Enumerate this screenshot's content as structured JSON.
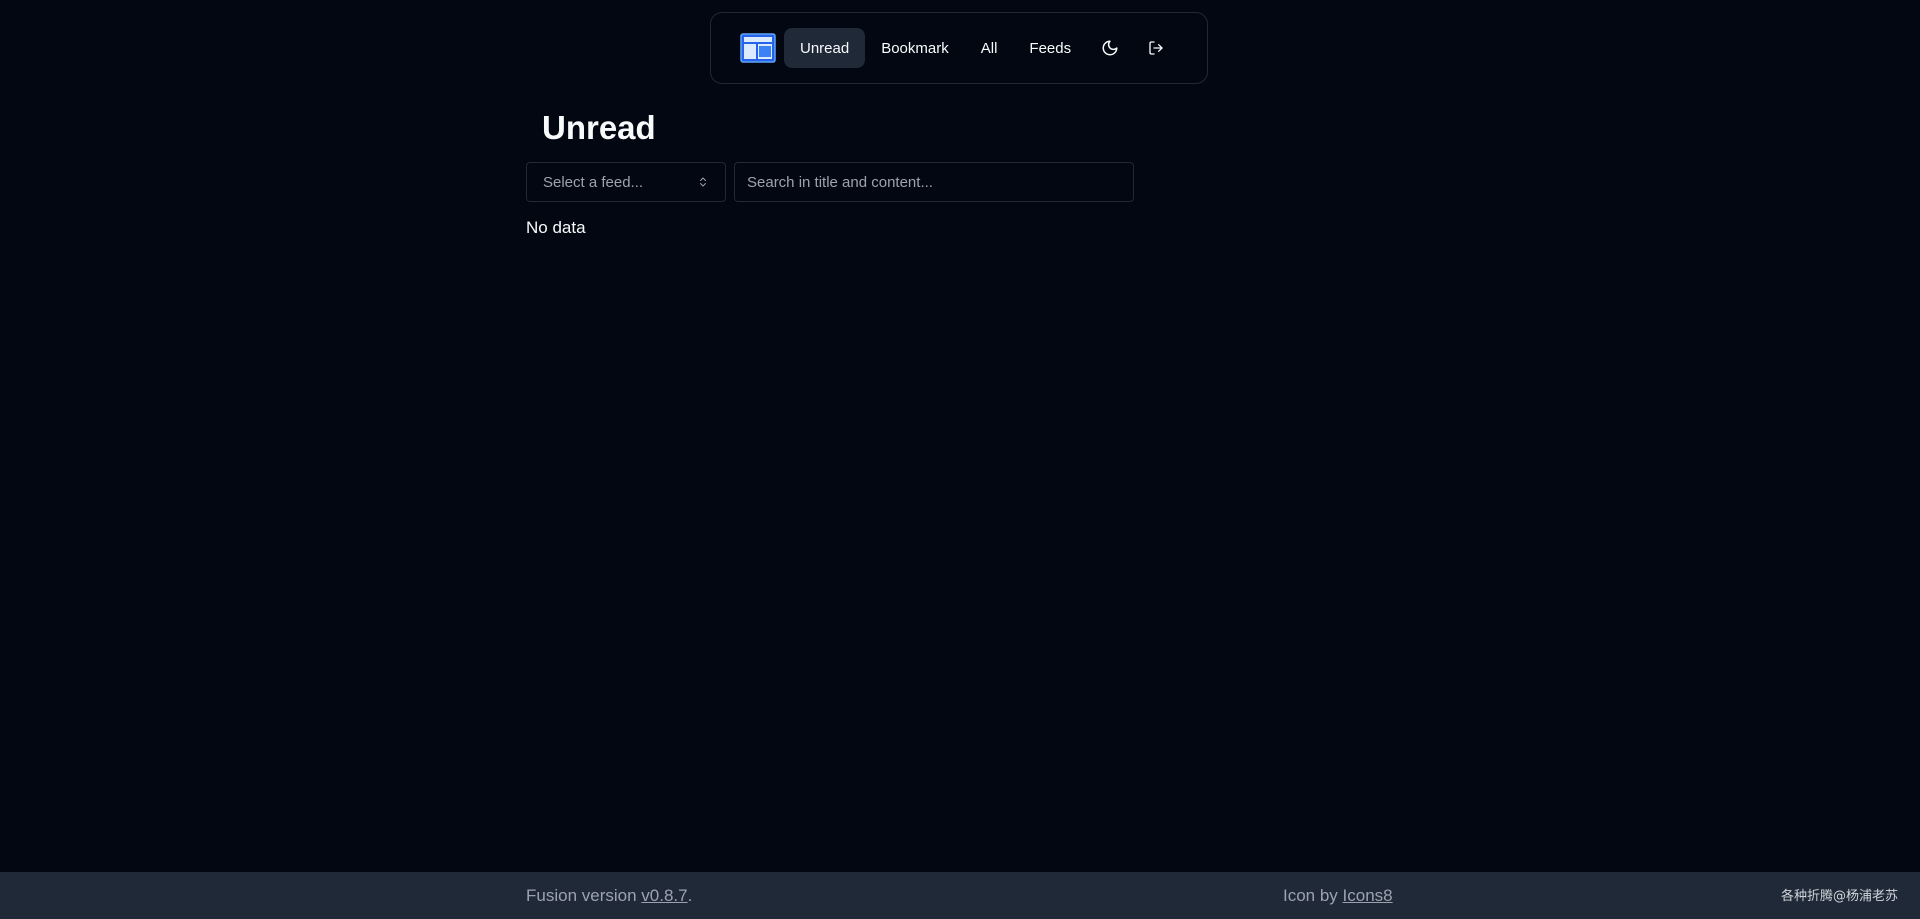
{
  "nav": {
    "logo_icon": "newspaper-layout-icon",
    "items": [
      {
        "label": "Unread",
        "active": true
      },
      {
        "label": "Bookmark",
        "active": false
      },
      {
        "label": "All",
        "active": false
      },
      {
        "label": "Feeds",
        "active": false
      }
    ],
    "theme_icon": "moon-icon",
    "logout_icon": "logout-icon"
  },
  "main": {
    "title": "Unread",
    "feed_select_placeholder": "Select a feed...",
    "search_placeholder": "Search in title and content...",
    "empty_message": "No data"
  },
  "footer": {
    "version_prefix": "Fusion version ",
    "version_link": "v0.8.7",
    "version_suffix": ".",
    "icon_prefix": "Icon by ",
    "icon_link": "Icons8",
    "watermark": "各种折腾@杨浦老苏"
  },
  "colors": {
    "background": "#030712",
    "surface": "#1f2937",
    "text": "#f9fafb",
    "muted": "#9ca3af",
    "logo_blue": "#3b82f6"
  }
}
